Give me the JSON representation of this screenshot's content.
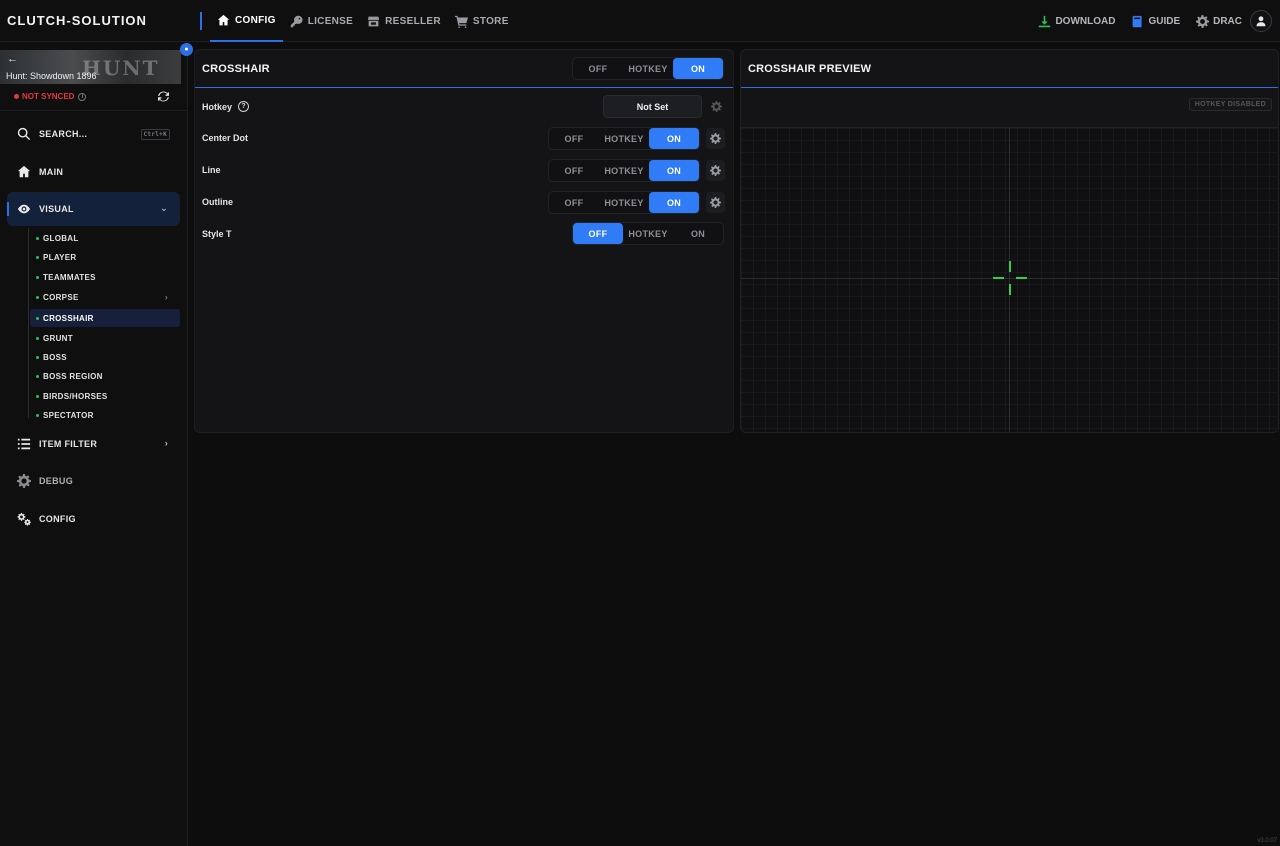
{
  "app": {
    "brand": "CLUTCH-SOLUTION",
    "version": "v3.0.07"
  },
  "topnav": [
    {
      "label": "CONFIG",
      "icon": "home-icon",
      "active": true
    },
    {
      "label": "LICENSE",
      "icon": "key-icon"
    },
    {
      "label": "RESELLER",
      "icon": "store-icon"
    },
    {
      "label": "STORE",
      "icon": "cart-icon"
    }
  ],
  "topright": {
    "download": "DOWNLOAD",
    "guide": "GUIDE",
    "user": "DRAC"
  },
  "colors": {
    "accent": "#2f7cf6",
    "crosshair": "#2ed14a",
    "error": "#e23a3a",
    "success": "#2fbf5a"
  },
  "sidebar": {
    "game": "Hunt: Showdown 1896",
    "game_logo_text": "HUNT",
    "sync_status": "NOT SYNCED",
    "search": {
      "label": "SEARCH...",
      "shortcut": "Ctrl+K"
    },
    "main": "MAIN",
    "visual": "VISUAL",
    "visual_items": [
      "GLOBAL",
      "PLAYER",
      "TEAMMATES",
      "CORPSE",
      "CROSSHAIR",
      "GRUNT",
      "BOSS",
      "BOSS REGION",
      "BIRDS/HORSES",
      "SPECTATOR"
    ],
    "item_filter": "ITEM FILTER",
    "debug": "DEBUG",
    "config": "CONFIG"
  },
  "crosshair_panel": {
    "title": "CROSSHAIR",
    "segment_labels": {
      "off": "OFF",
      "hotkey": "HOTKEY",
      "on": "ON"
    },
    "master_state": "ON",
    "hotkey_label": "Hotkey",
    "hotkey_value": "Not Set",
    "rows": [
      {
        "label": "Center Dot",
        "state": "ON"
      },
      {
        "label": "Line",
        "state": "ON"
      },
      {
        "label": "Outline",
        "state": "ON"
      },
      {
        "label": "Style T",
        "state": "OFF"
      }
    ]
  },
  "preview_panel": {
    "title": "CROSSHAIR PREVIEW",
    "badge": "HOTKEY DISABLED"
  }
}
